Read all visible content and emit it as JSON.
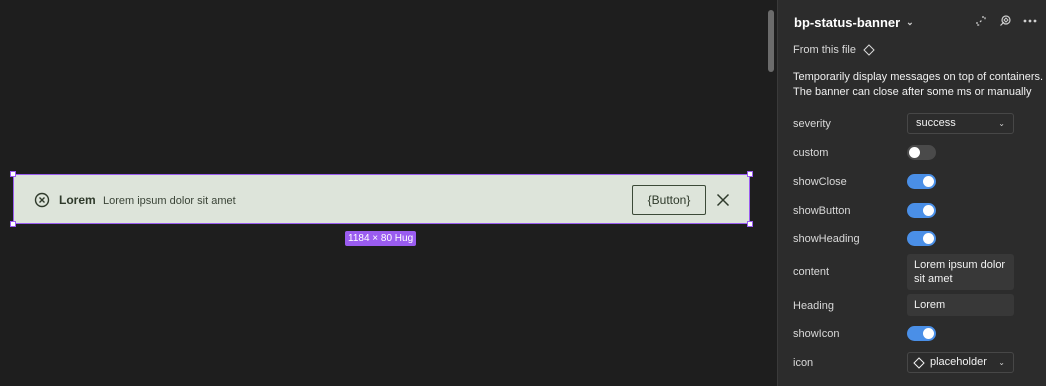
{
  "canvas": {
    "banner": {
      "heading": "Lorem",
      "content": "Lorem ipsum dolor sit amet",
      "button_label": "{Button}",
      "size_badge": "1184 × 80 Hug"
    }
  },
  "panel": {
    "component_name": "bp-status-banner",
    "source": "From this file",
    "description_lines": [
      "Temporarily display messages on top of containers.",
      "The banner can close after some ms or manually"
    ],
    "properties": [
      {
        "label": "severity",
        "type": "select",
        "value": "success"
      },
      {
        "label": "custom",
        "type": "toggle",
        "value": false
      },
      {
        "label": "showClose",
        "type": "toggle",
        "value": true
      },
      {
        "label": "showButton",
        "type": "toggle",
        "value": true
      },
      {
        "label": "showHeading",
        "type": "toggle",
        "value": true
      },
      {
        "label": "content",
        "type": "text",
        "value_lines": [
          "Lorem ipsum dolor",
          "sit amet"
        ]
      },
      {
        "label": "Heading",
        "type": "text",
        "value": "Lorem"
      },
      {
        "label": "showIcon",
        "type": "toggle",
        "value": true
      },
      {
        "label": "icon",
        "type": "select",
        "value": "placeholder"
      }
    ]
  },
  "colors": {
    "accent": "#9a5cf0",
    "toggle_on": "#4a8fe7",
    "banner_bg": "#dde4da"
  },
  "icons": [
    "circle-x-icon",
    "close-icon",
    "detach-icon",
    "component-link-icon",
    "more-icon",
    "diamond-icon",
    "chevron-down-icon"
  ]
}
